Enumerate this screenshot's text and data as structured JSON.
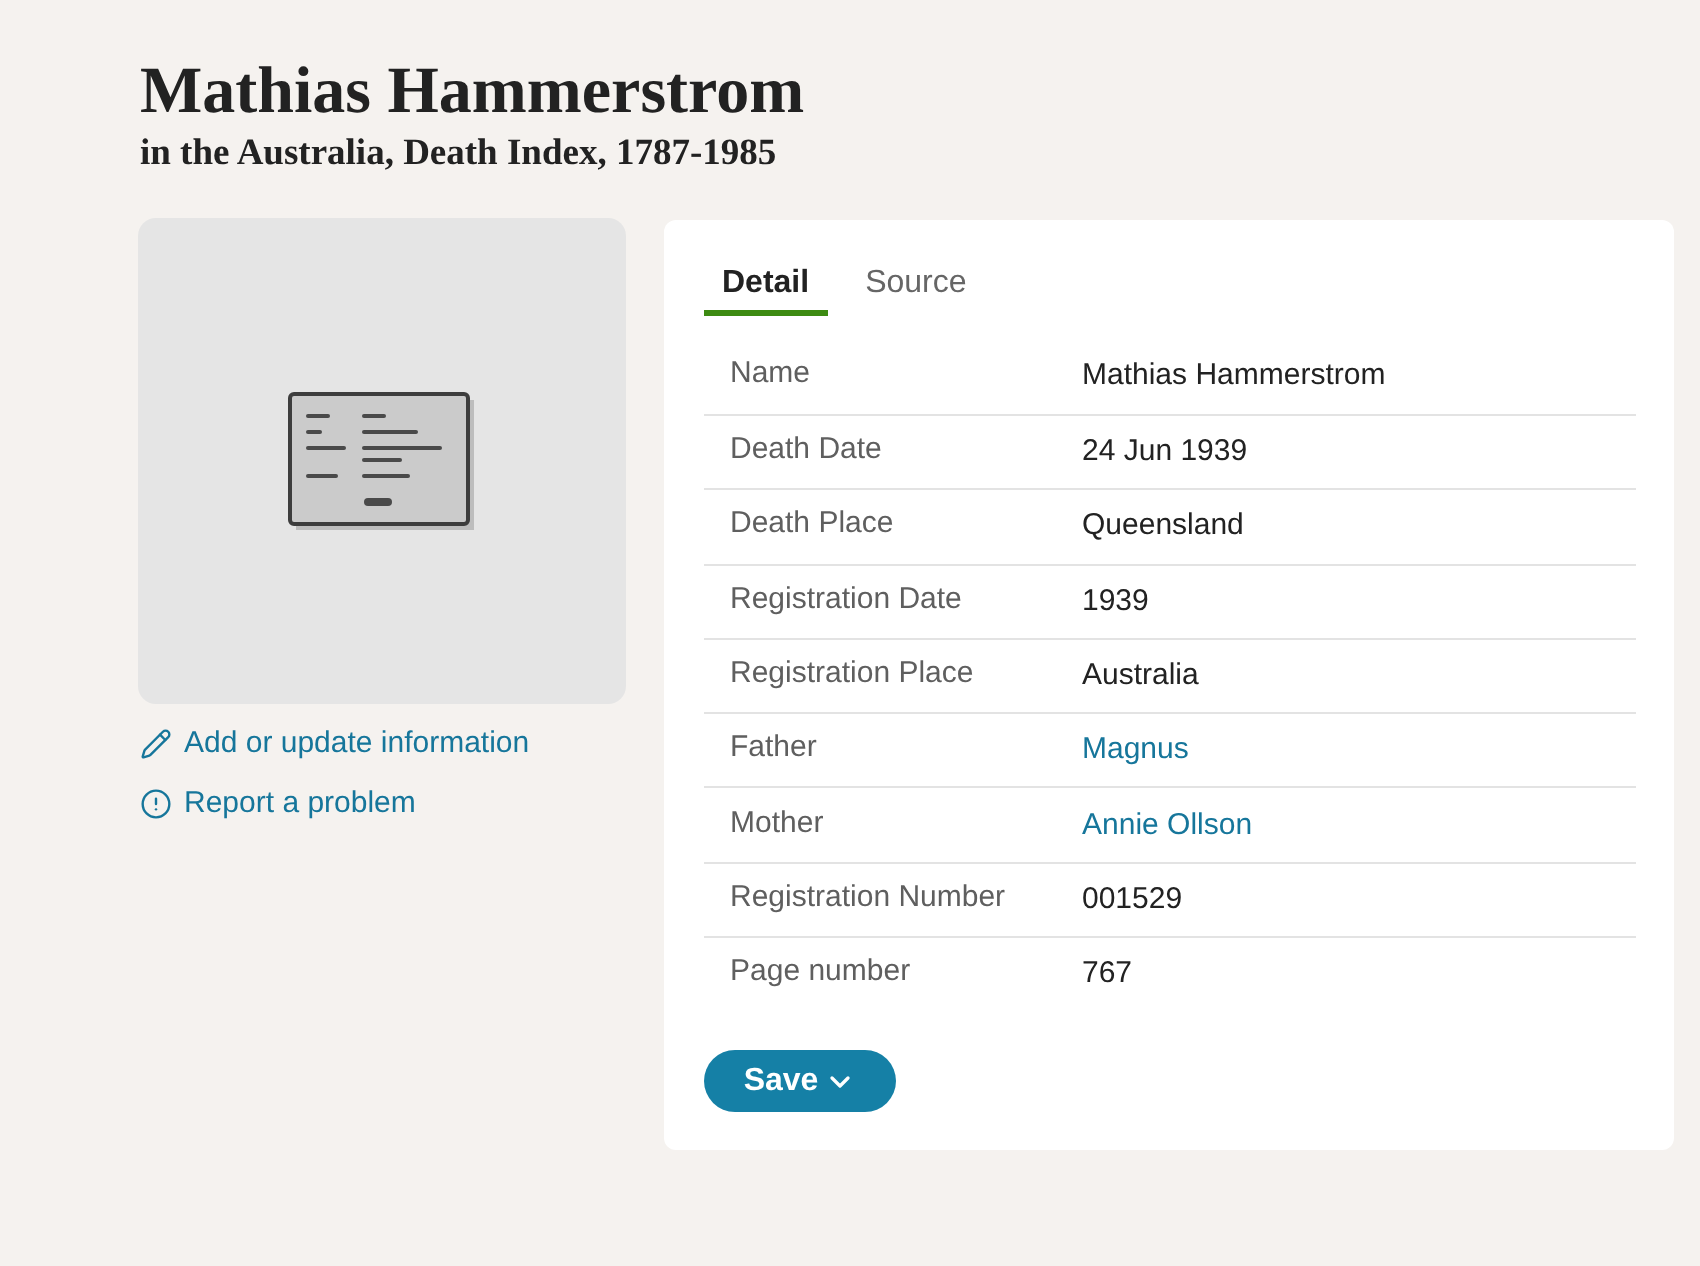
{
  "record": {
    "name": "Mathias Hammerstrom",
    "collection": "in the Australia, Death Index, 1787-1985"
  },
  "actions": [
    {
      "kind": "edit",
      "label": "Add or update information"
    },
    {
      "kind": "report",
      "label": "Report a problem"
    }
  ],
  "tabs": [
    {
      "label": "Detail",
      "selected": true
    },
    {
      "label": "Source",
      "selected": false
    }
  ],
  "fields": [
    {
      "label": "Name",
      "value": "Mathias Hammerstrom",
      "kind": "text"
    },
    {
      "label": "Death Date",
      "value": "24 Jun 1939",
      "kind": "text"
    },
    {
      "label": "Death Place",
      "value": "Queensland",
      "kind": "text"
    },
    {
      "label": "Registration Date",
      "value": "1939",
      "kind": "text"
    },
    {
      "label": "Registration Place",
      "value": "Australia",
      "kind": "text"
    },
    {
      "label": "Father",
      "value": "Magnus",
      "kind": "link"
    },
    {
      "label": "Mother",
      "value": "Annie Ollson",
      "kind": "link"
    },
    {
      "label": "Registration Number",
      "value": "001529",
      "kind": "text"
    },
    {
      "label": "Page number",
      "value": "767",
      "kind": "text"
    }
  ],
  "save_button": {
    "label": "Save"
  }
}
